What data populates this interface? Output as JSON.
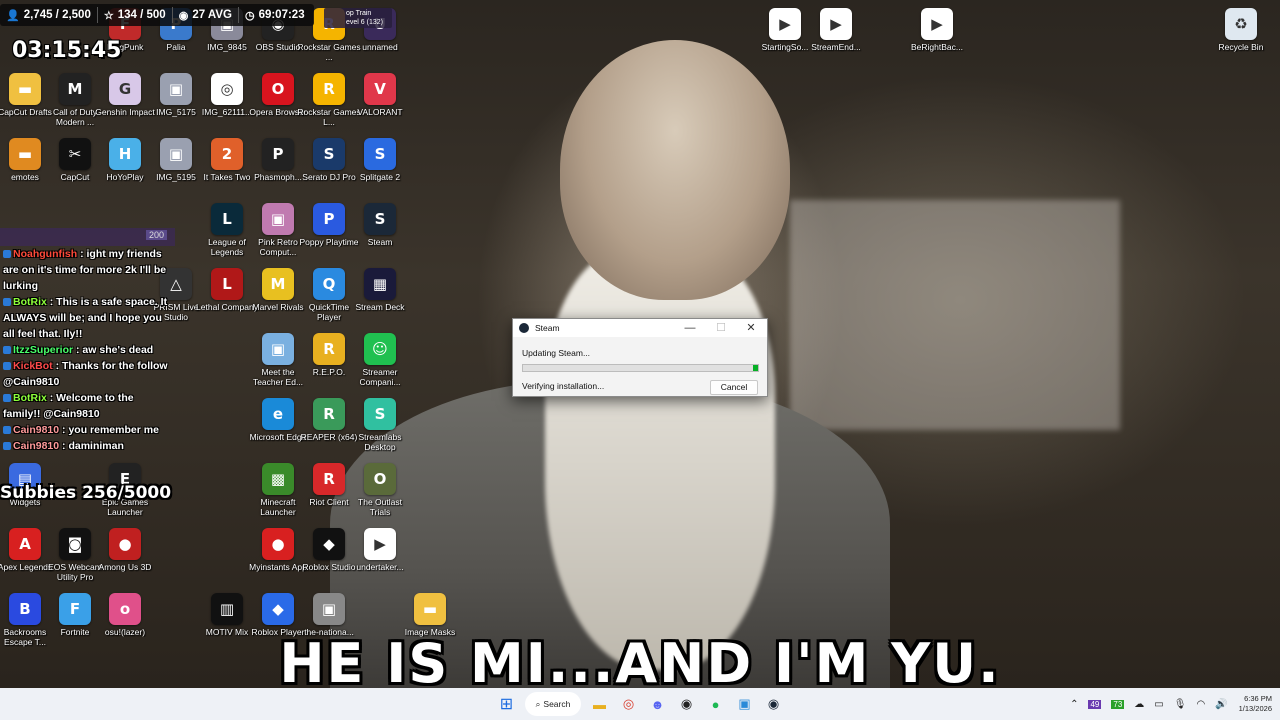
{
  "overlay": {
    "stats": [
      {
        "icon": "person-icon",
        "value": "2,745 / 2,500"
      },
      {
        "icon": "star-icon",
        "value": "134 / 500"
      },
      {
        "icon": "eye-icon",
        "value": "27 AVG"
      },
      {
        "icon": "clock-icon",
        "value": "69:07:23"
      }
    ],
    "stream_clock": "03:15:45",
    "train_banner": "op Train\nevel 6 (132)",
    "chat_header_count": "200",
    "subs_goal": "Subbies 256/5000",
    "chat": [
      {
        "user": "Noahgunfish",
        "text": ": ight my friends are on it's time for more 2k I'll be lurking",
        "color": "#ff4a3a"
      },
      {
        "user": "BotRix",
        "text": ": This is a safe space. It ALWAYS will be; and I hope you all feel that. Ily!!",
        "color": "#8dff3a"
      },
      {
        "user": "ItzzSuperior",
        "text": ": aw she's dead",
        "color": "#4aff6a"
      },
      {
        "user": "KickBot",
        "text": ": Thanks for the follow @Cain9810",
        "color": "#ff4a4a"
      },
      {
        "user": "BotRix",
        "text": ": Welcome to the family!! @Cain9810",
        "color": "#8dff3a"
      },
      {
        "user": "Cain9810",
        "text": ": you remember me",
        "color": "#ff9a9a"
      },
      {
        "user": "Cain9810",
        "text": ": daminiman",
        "color": "#ff9a9a"
      }
    ]
  },
  "desktop": {
    "icons": [
      {
        "label": "unnamed",
        "icon": "unnamed-icon",
        "color": "#3a2a5a",
        "glyph": "U"
      },
      {
        "label": "Rockstar Games ...",
        "icon": "rockstar-icon",
        "color": "#f5b400",
        "glyph": "R"
      },
      {
        "label": "OBS Studio",
        "icon": "obs-icon",
        "color": "#222",
        "glyph": "◉"
      },
      {
        "label": "IMG_9845",
        "icon": "image-icon",
        "color": "#8a8a9a",
        "glyph": "▣"
      },
      {
        "label": "Palia",
        "icon": "palia-icon",
        "color": "#3a7acc",
        "glyph": "P"
      },
      {
        "label": "FragPunk",
        "icon": "fragpunk-icon",
        "color": "#c02a2a",
        "glyph": "F"
      },
      {
        "label": "CapCut Drafts",
        "icon": "folder-icon",
        "color": "#f0c040",
        "glyph": "▬"
      },
      {
        "label": "Call of Duty Modern ...",
        "icon": "cod-icon",
        "color": "#222",
        "glyph": "M"
      },
      {
        "label": "Genshin Impact",
        "icon": "genshin-icon",
        "color": "#d8c8e8",
        "glyph": "G"
      },
      {
        "label": "IMG_5175",
        "icon": "image-icon",
        "color": "#9aa0b0",
        "glyph": "▣"
      },
      {
        "label": "IMG_62111...",
        "icon": "chrome-icon",
        "color": "#ffffff",
        "glyph": "◎"
      },
      {
        "label": "Opera Browser",
        "icon": "opera-icon",
        "color": "#d8141e",
        "glyph": "O"
      },
      {
        "label": "Rockstar Games L...",
        "icon": "rockstar-icon",
        "color": "#f5b400",
        "glyph": "R"
      },
      {
        "label": "VALORANT",
        "icon": "valorant-icon",
        "color": "#e0374a",
        "glyph": "V"
      },
      {
        "label": "emotes",
        "icon": "folder-icon",
        "color": "#e08a20",
        "glyph": "▬"
      },
      {
        "label": "CapCut",
        "icon": "capcut-icon",
        "color": "#111",
        "glyph": "✂"
      },
      {
        "label": "HoYoPlay",
        "icon": "hoyoplay-icon",
        "color": "#4ab0e8",
        "glyph": "H"
      },
      {
        "label": "IMG_5195",
        "icon": "image-icon",
        "color": "#9aa0b0",
        "glyph": "▣"
      },
      {
        "label": "It Takes Two",
        "icon": "ittakestwo-icon",
        "color": "#e0602a",
        "glyph": "2"
      },
      {
        "label": "Phasmoph...",
        "icon": "phasmophobia-icon",
        "color": "#222",
        "glyph": "P"
      },
      {
        "label": "Serato DJ Pro",
        "icon": "serato-icon",
        "color": "#1a3a6a",
        "glyph": "S"
      },
      {
        "label": "Splitgate 2",
        "icon": "splitgate-icon",
        "color": "#2a6ae0",
        "glyph": "S"
      },
      {
        "label": "League of Legends",
        "icon": "league-icon",
        "color": "#0a2a3a",
        "glyph": "L"
      },
      {
        "label": "Pink Retro Comput...",
        "icon": "image-icon",
        "color": "#c07ab0",
        "glyph": "▣"
      },
      {
        "label": "Poppy Playtime",
        "icon": "poppy-icon",
        "color": "#2a5ae0",
        "glyph": "P"
      },
      {
        "label": "Steam",
        "icon": "steam-icon",
        "color": "#1b2838",
        "glyph": "S"
      },
      {
        "label": "PRISM Live Studio",
        "icon": "prism-icon",
        "color": "#333",
        "glyph": "△"
      },
      {
        "label": "Lethal Company",
        "icon": "lethal-icon",
        "color": "#b01818",
        "glyph": "L"
      },
      {
        "label": "Marvel Rivals",
        "icon": "marvel-icon",
        "color": "#e8c020",
        "glyph": "M"
      },
      {
        "label": "QuickTime Player",
        "icon": "quicktime-icon",
        "color": "#2a8ae0",
        "glyph": "Q"
      },
      {
        "label": "Stream Deck",
        "icon": "streamdeck-icon",
        "color": "#1a1a3a",
        "glyph": "▦"
      },
      {
        "label": "Meet the Teacher Ed...",
        "icon": "image-icon",
        "color": "#7ab0e0",
        "glyph": "▣"
      },
      {
        "label": "R.E.P.O.",
        "icon": "repo-icon",
        "color": "#e8b020",
        "glyph": "R"
      },
      {
        "label": "Streamer Compani...",
        "icon": "streamer-companion-icon",
        "color": "#20c050",
        "glyph": "☺"
      },
      {
        "label": "Microsoft Edge",
        "icon": "edge-icon",
        "color": "#1a8ad8",
        "glyph": "e"
      },
      {
        "label": "REAPER (x64)",
        "icon": "reaper-icon",
        "color": "#3a9a5a",
        "glyph": "R"
      },
      {
        "label": "Streamlabs Desktop",
        "icon": "streamlabs-icon",
        "color": "#30c0a0",
        "glyph": "S"
      },
      {
        "label": "Minecraft Launcher",
        "icon": "minecraft-icon",
        "color": "#3a8a2a",
        "glyph": "▩"
      },
      {
        "label": "Riot Client",
        "icon": "riot-icon",
        "color": "#d8282a",
        "glyph": "R"
      },
      {
        "label": "The Outlast Trials",
        "icon": "outlast-icon",
        "color": "#5a6a3a",
        "glyph": "O"
      },
      {
        "label": "Widgets",
        "icon": "widgets-icon",
        "color": "#3a6ae0",
        "glyph": "▤"
      },
      {
        "label": "Epic Games Launcher",
        "icon": "epic-icon",
        "color": "#222",
        "glyph": "E"
      },
      {
        "label": "Myinstants App",
        "icon": "myinstants-icon",
        "color": "#d82020",
        "glyph": "●"
      },
      {
        "label": "Roblox Studio",
        "icon": "roblox-studio-icon",
        "color": "#111",
        "glyph": "◆"
      },
      {
        "label": "undertaker...",
        "icon": "video-icon",
        "color": "#ffffff",
        "glyph": "▶"
      },
      {
        "label": "Apex Legends",
        "icon": "apex-icon",
        "color": "#d82020",
        "glyph": "A"
      },
      {
        "label": "EOS Webcam Utility Pro",
        "icon": "eos-icon",
        "color": "#111",
        "glyph": "◙"
      },
      {
        "label": "Among Us 3D",
        "icon": "amongus-icon",
        "color": "#c02020",
        "glyph": "●"
      },
      {
        "label": "Backrooms Escape T...",
        "icon": "backrooms-icon",
        "color": "#2a4ae0",
        "glyph": "B"
      },
      {
        "label": "Fortnite",
        "icon": "fortnite-icon",
        "color": "#3aa0e8",
        "glyph": "F"
      },
      {
        "label": "osu!(lazer)",
        "icon": "osu-icon",
        "color": "#e0508a",
        "glyph": "o"
      },
      {
        "label": "MOTIV Mix",
        "icon": "motiv-icon",
        "color": "#111",
        "glyph": "▥"
      },
      {
        "label": "Roblox Player",
        "icon": "roblox-icon",
        "color": "#2a6ae8",
        "glyph": "◆"
      },
      {
        "label": "the-nationa...",
        "icon": "image-icon",
        "color": "#888",
        "glyph": "▣"
      },
      {
        "label": "Image Masks",
        "icon": "folder-icon",
        "color": "#f0c040",
        "glyph": "▬"
      },
      {
        "label": "StartingSo...",
        "icon": "video-icon",
        "color": "#ffffff",
        "glyph": "▶"
      },
      {
        "label": "StreamEnd...",
        "icon": "video-icon",
        "color": "#ffffff",
        "glyph": "▶"
      },
      {
        "label": "BeRightBac...",
        "icon": "video-icon",
        "color": "#ffffff",
        "glyph": "▶"
      },
      {
        "label": "Recycle Bin",
        "icon": "recycle-bin-icon",
        "color": "#dfe8f0",
        "glyph": "♻"
      }
    ]
  },
  "wallpaper": {
    "caption": "HE IS MI...AND I'M YU."
  },
  "steam_dialog": {
    "title": "Steam",
    "status": "Updating Steam...",
    "detail": "Verifying installation...",
    "cancel_label": "Cancel",
    "progress": 0.02,
    "minimize": "—",
    "maximize": "☐",
    "close": "✕"
  },
  "taskbar": {
    "search_label": "Search",
    "apps": [
      "start-icon",
      "search",
      "file-explorer-icon",
      "chrome-icon",
      "discord-icon",
      "obs-icon",
      "spotify-icon",
      "photos-icon",
      "steam-icon"
    ],
    "tray": [
      "chevron-up-icon",
      "49",
      "73",
      "onedrive-icon",
      "battery-icon",
      "mic-icon",
      "wifi-icon",
      "volume-icon"
    ],
    "time": "6:36 PM",
    "date": "1/13/2026"
  }
}
